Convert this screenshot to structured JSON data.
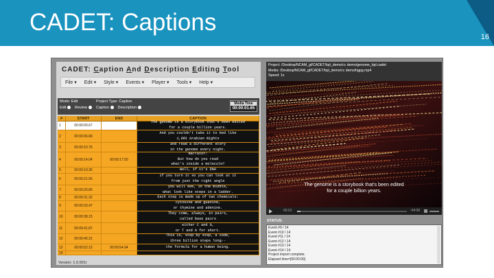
{
  "slide": {
    "title": "CADET: Captions",
    "page_number": "16"
  },
  "app": {
    "title_parts": [
      {
        "text": "CADET: ",
        "u": false
      },
      {
        "text": "C",
        "u": true
      },
      {
        "text": "aption ",
        "u": false
      },
      {
        "text": "A",
        "u": true
      },
      {
        "text": "nd ",
        "u": false
      },
      {
        "text": "D",
        "u": true
      },
      {
        "text": "escription ",
        "u": false
      },
      {
        "text": "E",
        "u": true
      },
      {
        "text": "diting ",
        "u": false
      },
      {
        "text": "T",
        "u": true
      },
      {
        "text": "ool",
        "u": false
      }
    ],
    "menu": [
      "File",
      "Edit",
      "Style",
      "Events",
      "Player",
      "Tools",
      "Help"
    ],
    "mode_label": "Mode: Edit",
    "project_type_label": "Project Type: Caption",
    "edit_radio": "Edit",
    "review_radio": "Review",
    "caption_radio": "Caption",
    "description_radio": "Description",
    "media_time_label": "Media Time",
    "media_time_value": "00:00:01.65",
    "columns": [
      "#",
      "START",
      "END",
      "CAPTION"
    ],
    "version": "Version: 1.0.001r"
  },
  "rows": [
    {
      "num": "1",
      "start": "00:00:00.67",
      "end": "",
      "caption": [
        "The genome is a storybook that's been edited",
        "for a couple billion years."
      ],
      "h": 13,
      "selected": true
    },
    {
      "num": "2",
      "start": "00:00:06.68",
      "end": "",
      "caption": [
        "And you couldn't take it to bed like",
        "1,001 Arabian Nights"
      ],
      "h": 18,
      "selected": false
    },
    {
      "num": "3",
      "start": "00:00:10.76",
      "end": "",
      "caption": [
        "and read a different story",
        "in the genome every night."
      ],
      "h": 14,
      "selected": false
    },
    {
      "num": "4",
      "start": "00:00:14.04",
      "end": "00:00:17.50",
      "caption": [
        "Narrator:",
        "But how do you read",
        "what's inside a molecule?"
      ],
      "h": 22,
      "selected": false
    },
    {
      "num": "5",
      "start": "00:00:19.36",
      "end": "",
      "caption": [
        "Well, if it's DNA"
      ],
      "h": 9,
      "selected": false
    },
    {
      "num": "6",
      "start": "00:00:21.56",
      "end": "",
      "caption": [
        "if you turn it so you can look at it",
        "from just the right angle"
      ],
      "h": 17,
      "selected": false
    },
    {
      "num": "7",
      "start": "00:00:25.85",
      "end": "",
      "caption": [
        "you will see, in the middle,",
        "what look like steps in a ladder."
      ],
      "h": 14,
      "selected": false
    },
    {
      "num": "8",
      "start": "00:00:31.32",
      "end": "",
      "caption": [
        "Each step is made up of two chemicals:"
      ],
      "h": 9,
      "selected": false
    },
    {
      "num": "9",
      "start": "00:00:33.47",
      "end": "",
      "caption": [
        "cytosine and guanine,",
        "or thymine and adenine."
      ],
      "h": 15,
      "selected": false
    },
    {
      "num": "10",
      "start": "00:00:38.15",
      "end": "",
      "caption": [
        "They come, always, in pairs,",
        "called base pairs"
      ],
      "h": 17,
      "selected": false
    },
    {
      "num": "11",
      "start": "00:00:41.87",
      "end": "",
      "caption": [
        "either C and G,",
        "or T and A for short."
      ],
      "h": 16,
      "selected": false
    },
    {
      "num": "12",
      "start": "00:00:46.31",
      "end": "",
      "caption": [
        "This is, step by step, a code,",
        "three billion steps long--"
      ],
      "h": 15,
      "selected": false
    },
    {
      "num": "13",
      "start": "00:00:52.15",
      "end": "00:00:54.94",
      "caption": [
        "the formula for a human being."
      ],
      "h": 10,
      "selected": false
    },
    {
      "num": "14",
      "start": "",
      "end": "",
      "caption": [],
      "h": 6,
      "selected": false
    }
  ],
  "media": {
    "project": "Project: /Desktop/NCAM_gf/CADET/bpl_demo/cc demo/genome_bpl.cadet",
    "media_file": "Media: /Desktop/NCAM_gf/CADET/bpl_demo/cc demo/hgpg.mp4",
    "speed": "Speed: 1x",
    "subtitle_line1": "The genome is a storybook that's been edited",
    "subtitle_line2": "for a couple billion years.",
    "current_time": "00:01",
    "remaining_time": "-04:06",
    "progress": 0.03
  },
  "status": {
    "label": "STATUS:",
    "lines": [
      "Event #9 / 14",
      "Event #10 / 14",
      "Event #11 / 14",
      "Event #12 / 14",
      "Event #13 / 14",
      "Event #14 / 14",
      "Project import complete.",
      "Elapsed time=[00:00:00]"
    ]
  },
  "colors": {
    "header": "#1a93bf",
    "table_orange": "#f5a623",
    "caption_bg": "#111111"
  }
}
